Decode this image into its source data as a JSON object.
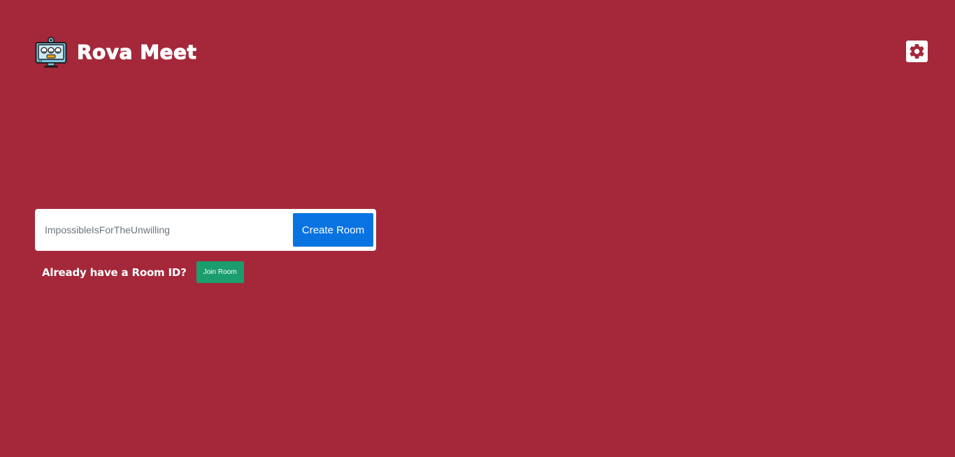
{
  "header": {
    "app_name": "Rova Meet",
    "logo_icon": "video-meeting-monitor-icon",
    "settings_icon": "gear-icon"
  },
  "create_room": {
    "input_placeholder": "ImpossibleIsForTheUnwilling",
    "input_value": "",
    "button_label": "Create Room"
  },
  "join_room": {
    "prompt": "Already have a Room ID?",
    "button_label": "Join Room"
  },
  "colors": {
    "background": "#a4283a",
    "create_button": "#0a73e2",
    "join_button": "#1b9d6e"
  }
}
